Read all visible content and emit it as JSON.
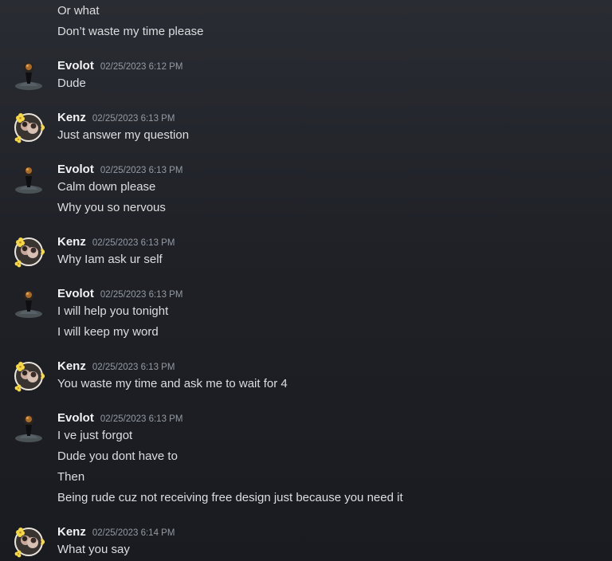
{
  "messages": {
    "m0": {
      "lines": [
        "Or what",
        "Don’t waste my time please"
      ]
    },
    "m1": {
      "author": "Evolot",
      "timestamp": "02/25/2023 6:12 PM",
      "lines": [
        "Dude"
      ]
    },
    "m2": {
      "author": "Kenz",
      "timestamp": "02/25/2023 6:13 PM",
      "lines": [
        "Just answer my question"
      ]
    },
    "m3": {
      "author": "Evolot",
      "timestamp": "02/25/2023 6:13 PM",
      "lines": [
        "Calm down please",
        "Why you so nervous"
      ]
    },
    "m4": {
      "author": "Kenz",
      "timestamp": "02/25/2023 6:13 PM",
      "lines": [
        "Why Iam ask ur self"
      ]
    },
    "m5": {
      "author": "Evolot",
      "timestamp": "02/25/2023 6:13 PM",
      "lines": [
        "I will help you tonight",
        "I will keep my word"
      ]
    },
    "m6": {
      "author": "Kenz",
      "timestamp": "02/25/2023 6:13 PM",
      "lines": [
        "You waste my time and ask me to wait for 4"
      ]
    },
    "m7": {
      "author": "Evolot",
      "timestamp": "02/25/2023 6:13 PM",
      "lines": [
        "I ve just forgot",
        "Dude you dont have to",
        "Then",
        "Being rude cuz not receiving free design just because you need it"
      ]
    },
    "m8": {
      "author": "Kenz",
      "timestamp": "02/25/2023 6:14 PM",
      "lines": [
        "What you say"
      ]
    }
  },
  "avatars": {
    "evolot": "dark-figure-avatar-icon",
    "kenz": "flower-photo-avatar-icon"
  },
  "colors": {
    "background_top": "#2a2c33",
    "background_bottom": "#1a1b20",
    "text": "#dbdee1",
    "username": "#f2f3f5",
    "timestamp": "#949ba4"
  }
}
